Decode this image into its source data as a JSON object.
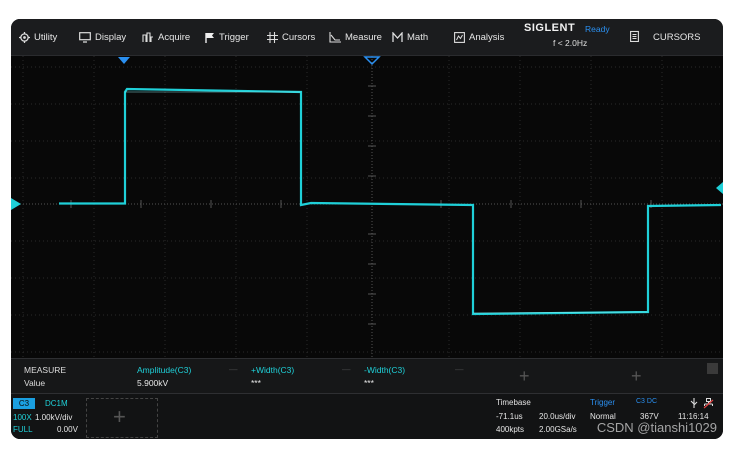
{
  "menu": {
    "utility": "Utility",
    "display": "Display",
    "acquire": "Acquire",
    "trigger": "Trigger",
    "cursors": "Cursors",
    "measure": "Measure",
    "math": "Math",
    "analysis": "Analysis"
  },
  "brand": {
    "name": "SIGLENT",
    "status": "Ready",
    "freq": "f < 2.0Hz"
  },
  "mode": "CURSORS",
  "measure": {
    "header": "MEASURE",
    "value_label": "Value",
    "columns": [
      {
        "name": "Amplitude(C3)",
        "value": "5.900kV"
      },
      {
        "name": "+Width(C3)",
        "value": "***"
      },
      {
        "name": "-Width(C3)",
        "value": "***"
      }
    ],
    "dash": "—"
  },
  "channel": {
    "name": "C3",
    "coupling": "DC1M",
    "probe": "100X",
    "scale": "1.00kV/div",
    "bandwidth": "FULL",
    "offset": "0.00V"
  },
  "timebase": {
    "label": "Timebase",
    "delay": "-71.1us",
    "scale": "20.0us/div",
    "memory": "400kpts",
    "sample_rate": "2.00GSa/s"
  },
  "trigger": {
    "label": "Trigger",
    "source": "C3 DC",
    "mode": "Normal",
    "level": "367V",
    "time": "11:16:14"
  },
  "watermark": "CSDN @tianshi1029",
  "colors": {
    "trace": "#1fd0d8",
    "accent": "#2a8ff0",
    "background": "#0b0b0b"
  }
}
